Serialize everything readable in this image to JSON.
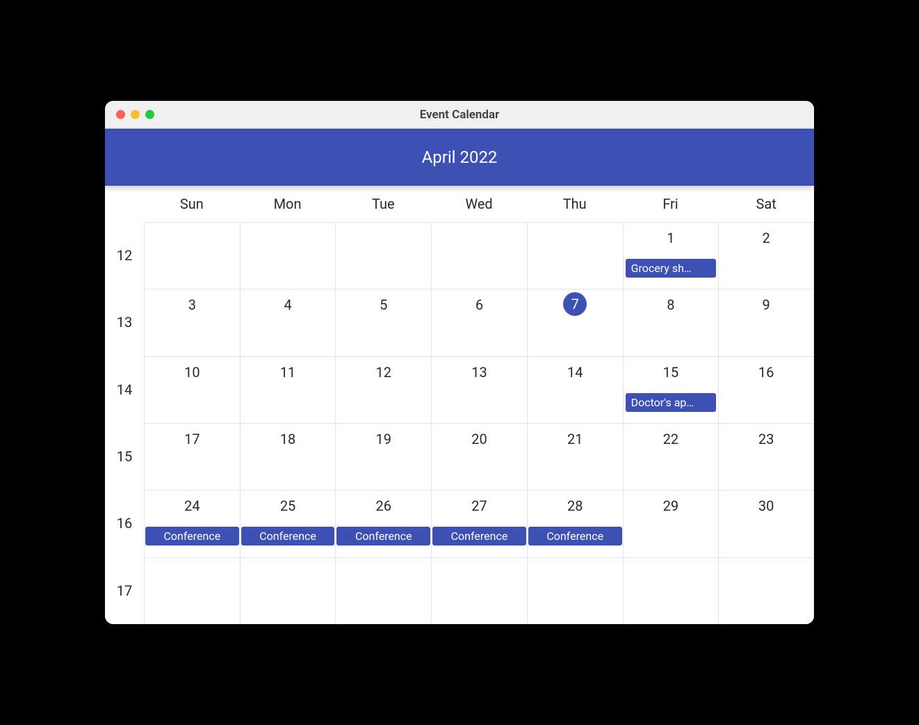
{
  "window": {
    "title": "Event Calendar"
  },
  "calendar": {
    "month_title": "April 2022",
    "weekdays": [
      "Sun",
      "Mon",
      "Tue",
      "Wed",
      "Thu",
      "Fri",
      "Sat"
    ],
    "today": 7,
    "weeks": [
      {
        "number": "12",
        "days": [
          {
            "n": "",
            "outside": true
          },
          {
            "n": "",
            "outside": true
          },
          {
            "n": "",
            "outside": true
          },
          {
            "n": "",
            "outside": true
          },
          {
            "n": "",
            "outside": true
          },
          {
            "n": "1",
            "event": "Grocery sh…"
          },
          {
            "n": "2"
          }
        ]
      },
      {
        "number": "13",
        "days": [
          {
            "n": "3"
          },
          {
            "n": "4"
          },
          {
            "n": "5"
          },
          {
            "n": "6"
          },
          {
            "n": "7",
            "today": true
          },
          {
            "n": "8"
          },
          {
            "n": "9"
          }
        ]
      },
      {
        "number": "14",
        "days": [
          {
            "n": "10"
          },
          {
            "n": "11"
          },
          {
            "n": "12"
          },
          {
            "n": "13"
          },
          {
            "n": "14"
          },
          {
            "n": "15",
            "event": "Doctor's ap…"
          },
          {
            "n": "16"
          }
        ]
      },
      {
        "number": "15",
        "days": [
          {
            "n": "17"
          },
          {
            "n": "18"
          },
          {
            "n": "19"
          },
          {
            "n": "20"
          },
          {
            "n": "21"
          },
          {
            "n": "22"
          },
          {
            "n": "23"
          }
        ]
      },
      {
        "number": "16",
        "days": [
          {
            "n": "24",
            "event": "Conference",
            "tight": true
          },
          {
            "n": "25",
            "event": "Conference",
            "tight": true
          },
          {
            "n": "26",
            "event": "Conference",
            "tight": true
          },
          {
            "n": "27",
            "event": "Conference",
            "tight": true
          },
          {
            "n": "28",
            "event": "Conference",
            "tight": true
          },
          {
            "n": "29"
          },
          {
            "n": "30"
          }
        ]
      },
      {
        "number": "17",
        "days": [
          {
            "n": "",
            "outside": true
          },
          {
            "n": "",
            "outside": true
          },
          {
            "n": "",
            "outside": true
          },
          {
            "n": "",
            "outside": true
          },
          {
            "n": "",
            "outside": true
          },
          {
            "n": "",
            "outside": true
          },
          {
            "n": "",
            "outside": true
          }
        ]
      }
    ]
  }
}
